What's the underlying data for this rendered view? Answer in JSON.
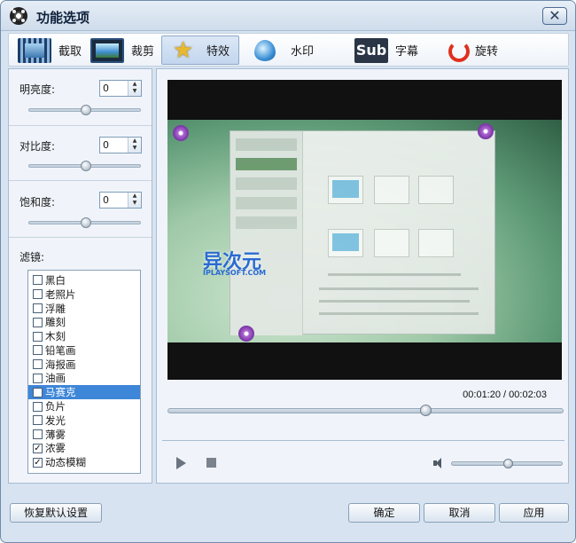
{
  "window": {
    "title": "功能选项",
    "close_label": "✕"
  },
  "toolbar": {
    "items": [
      {
        "label": "截取",
        "icon": "film-capture-icon",
        "active": false
      },
      {
        "label": "裁剪",
        "icon": "crop-icon",
        "active": false
      },
      {
        "label": "特效",
        "icon": "effect-star-icon",
        "active": true
      },
      {
        "label": "水印",
        "icon": "watermark-drop-icon",
        "active": false
      },
      {
        "label": "字幕",
        "icon": "subtitle-icon",
        "active": false
      },
      {
        "label": "旋转",
        "icon": "rotate-icon",
        "active": false
      }
    ],
    "subtitle_icon_text": "Sub"
  },
  "adjustments": {
    "brightness": {
      "label": "明亮度:",
      "value": "0",
      "slider_fraction": 0.5
    },
    "contrast": {
      "label": "对比度:",
      "value": "0",
      "slider_fraction": 0.5
    },
    "saturation": {
      "label": "饱和度:",
      "value": "0",
      "slider_fraction": 0.5
    }
  },
  "filters": {
    "label": "滤镜:",
    "items": [
      {
        "name": "黑白",
        "checked": false,
        "selected": false
      },
      {
        "name": "老照片",
        "checked": false,
        "selected": false
      },
      {
        "name": "浮雕",
        "checked": false,
        "selected": false
      },
      {
        "name": "雕刻",
        "checked": false,
        "selected": false
      },
      {
        "name": "木刻",
        "checked": false,
        "selected": false
      },
      {
        "name": "铅笔画",
        "checked": false,
        "selected": false
      },
      {
        "name": "海报画",
        "checked": false,
        "selected": false
      },
      {
        "name": "油画",
        "checked": false,
        "selected": false
      },
      {
        "name": "马赛克",
        "checked": false,
        "selected": true
      },
      {
        "name": "负片",
        "checked": false,
        "selected": false
      },
      {
        "name": "发光",
        "checked": false,
        "selected": false
      },
      {
        "name": "薄雾",
        "checked": false,
        "selected": false
      },
      {
        "name": "浓雾",
        "checked": true,
        "selected": false
      },
      {
        "name": "动态模糊",
        "checked": true,
        "selected": false
      }
    ]
  },
  "preview": {
    "logo_text": "异次元",
    "logo_subtext": "IPLAYSOFT.COM",
    "current_time": "00:01:20",
    "separator": "/",
    "total_time": "00:02:03",
    "seek_fraction": 0.65,
    "volume_fraction": 0.5
  },
  "buttons": {
    "restore": "恢复默认设置",
    "ok": "确定",
    "cancel": "取消",
    "apply": "应用"
  },
  "colors": {
    "window_bg": "#d7e3f0",
    "selected_filter": "#3d86d8",
    "active_tab": "#c2d6ee"
  }
}
